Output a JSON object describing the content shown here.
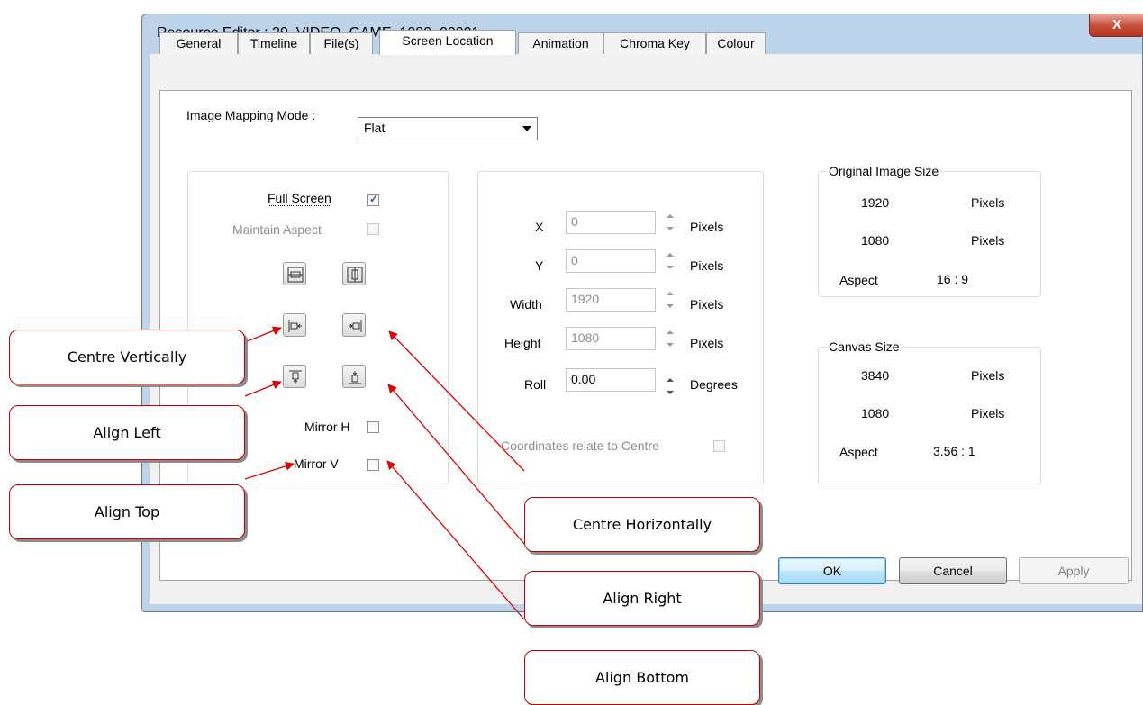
{
  "window": {
    "title": "Resource Editor  :  29_VIDEO_GAME_1080_00001",
    "close_label": "X"
  },
  "tabs": [
    "General",
    "Timeline",
    "File(s)",
    "Screen Location",
    "Animation",
    "Chroma Key",
    "Colour"
  ],
  "active_tab": "Screen Location",
  "mapping": {
    "label": "Image Mapping Mode :",
    "value": "Flat"
  },
  "left_group": {
    "full_screen_label": "Full Screen",
    "full_screen_checked": true,
    "maintain_aspect_label": "Maintain Aspect",
    "mirror_h_label": "Mirror H",
    "mirror_v_label": "Mirror V"
  },
  "position": {
    "x_label": "X",
    "x_value": "0",
    "x_unit": "Pixels",
    "y_label": "Y",
    "y_value": "0",
    "y_unit": "Pixels",
    "width_label": "Width",
    "width_value": "1920",
    "width_unit": "Pixels",
    "height_label": "Height",
    "height_value": "1080",
    "height_unit": "Pixels",
    "roll_label": "Roll",
    "roll_value": "0.00",
    "roll_unit": "Degrees",
    "coords_label": "Coordinates relate to Centre"
  },
  "original_size": {
    "title": "Original Image Size",
    "width": "1920",
    "width_unit": "Pixels",
    "height": "1080",
    "height_unit": "Pixels",
    "aspect_label": "Aspect",
    "aspect": "16 : 9"
  },
  "canvas_size": {
    "title": "Canvas Size",
    "width": "3840",
    "width_unit": "Pixels",
    "height": "1080",
    "height_unit": "Pixels",
    "aspect_label": "Aspect",
    "aspect": "3.56 : 1"
  },
  "buttons": {
    "ok": "OK",
    "cancel": "Cancel",
    "apply": "Apply"
  },
  "callouts": {
    "centre_vertically": "Centre Vertically",
    "align_left": "Align Left",
    "align_top": "Align Top",
    "centre_horizontally": "Centre Horizontally",
    "align_right": "Align Right",
    "align_bottom": "Align Bottom"
  },
  "colors": {
    "callout_border": "#c00000",
    "window_frame": "#bcd3ea",
    "close_button": "#c9513f"
  }
}
